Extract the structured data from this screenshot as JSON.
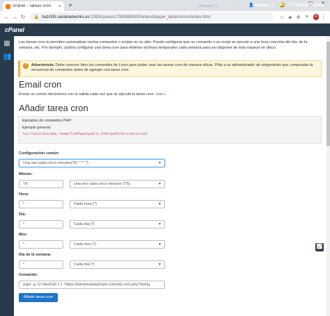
{
  "browser": {
    "tab_title": "cPanel - Tareas cron",
    "tab_close": "×",
    "new_tab": "+",
    "url_host": "ha1000.raiolanetworks.es",
    "url_path": ":2083/cpsess1799988500/frontend/paper_lantern/cron/index.html",
    "profile_initial": "A"
  },
  "cpanel": {
    "logo": "cPanel",
    "search_placeholder": "Buscar ( / )",
    "username": "bkkfqwz",
    "logout": "CERRAR SESIÓN"
  },
  "intro": {
    "text": "Las tareas cron le permiten automatizar ciertos comandos o scripts en su sitio. Puede configurar que un comando o un script se ejecute a una hora concreta del día, de la semana, etc. Por ejemplo, podría configurar una tarea cron para eliminar archivos temporales cada semana para así disponer de más espacio en disco."
  },
  "warning": {
    "label": "Advertencia:",
    "text": "Debe conocer bien los comandos de Linux para poder usar las tareas cron de manera eficaz. Pida a su administrador de alojamiento que compruebe la secuencia de comandos antes de agregar una tarea cron."
  },
  "email": {
    "heading": "Email cron",
    "subtext": "Enviar un correo electrónico con la salida cada vez que se ejecute la tarea cron.",
    "more": "más »"
  },
  "add": {
    "heading": "Añadir tarea cron",
    "examples_label": "Ejemplos de comandos PHP:",
    "general_label": "Ejemplo general:",
    "example_code": "/usr/local/bin/php /home/lc44fqwz/public_html/path/to/cron/script",
    "common_label": "Configuración común",
    "common_value": "Una vez cada cinco minutos(*/5 * * * *)",
    "minute_label": "Minuto:",
    "minute_value": "*/5",
    "minute_select": "Una vez cada cinco minutos (*/5)",
    "hour_label": "Hora:",
    "hour_value": "*",
    "hour_select": "Cada hora (*)",
    "day_label": "Día:",
    "day_value": "*",
    "day_select": "Cada día (*)",
    "month_label": "Mes:",
    "month_value": "*",
    "month_select": "Cada mes (*)",
    "weekday_label": "Día de la semana:",
    "weekday_value": "*",
    "weekday_select": "Cada día (*)",
    "command_label": "Comando:",
    "command_value": "wget -q -O /dev/null -t 1 \"https://dominiodeejemplo.com/wp-cron.php?doing",
    "submit": "Añadir tarea cron"
  },
  "colors": {
    "header_bg": "#293a4a",
    "primary": "#1d74c8",
    "warning_bg": "#fdf6dd"
  }
}
